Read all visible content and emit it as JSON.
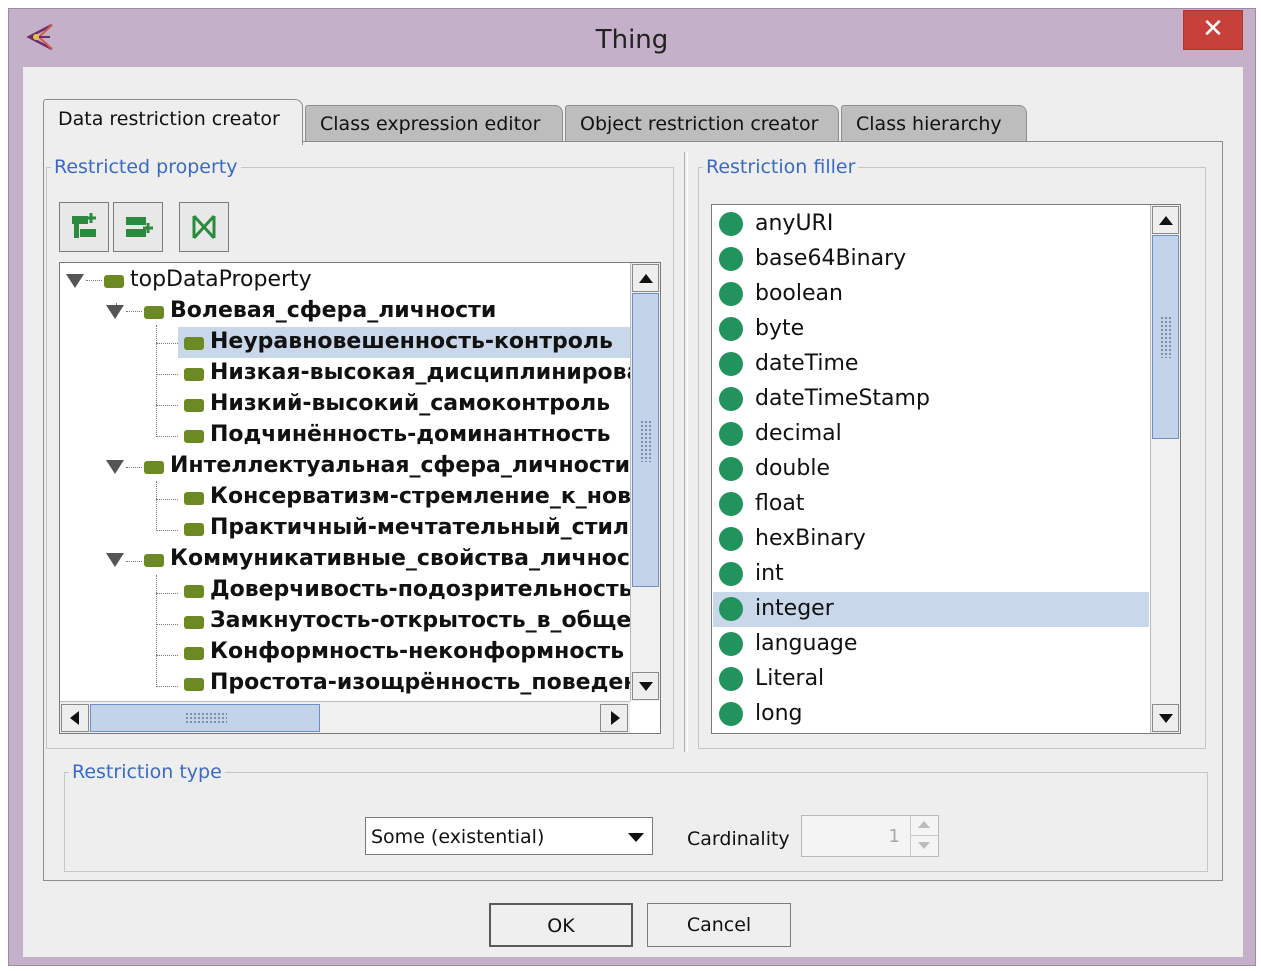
{
  "window": {
    "title": "Thing",
    "close_label": "✕"
  },
  "tabs": [
    {
      "label": "Data restriction creator",
      "active": true
    },
    {
      "label": "Class expression editor",
      "active": false
    },
    {
      "label": "Object restriction creator",
      "active": false
    },
    {
      "label": "Class hierarchy",
      "active": false
    }
  ],
  "restricted_property": {
    "legend": "Restricted property",
    "toolbar": [
      {
        "icon": "add-subproperty-icon"
      },
      {
        "icon": "add-sibling-property-icon"
      },
      {
        "icon": "delete-property-icon"
      }
    ],
    "tree": [
      {
        "label": "topDataProperty",
        "level": 0,
        "expanded": true,
        "bold": false,
        "selected": false
      },
      {
        "label": "Волевая_сфера_личности",
        "level": 1,
        "expanded": true,
        "bold": true,
        "selected": false
      },
      {
        "label": "Неуравновешенность-контроль",
        "level": 2,
        "bold": true,
        "selected": true
      },
      {
        "label": "Низкая-высокая_дисциплинированность",
        "level": 2,
        "bold": true,
        "selected": false
      },
      {
        "label": "Низкий-высокий_самоконтроль",
        "level": 2,
        "bold": true,
        "selected": false
      },
      {
        "label": "Подчинённость-доминантность",
        "level": 2,
        "bold": true,
        "selected": false
      },
      {
        "label": "Интеллектуальная_сфера_личности",
        "level": 1,
        "expanded": true,
        "bold": true,
        "selected": false
      },
      {
        "label": "Консерватизм-стремление_к_новому",
        "level": 2,
        "bold": true,
        "selected": false
      },
      {
        "label": "Практичный-мечтательный_стиль",
        "level": 2,
        "bold": true,
        "selected": false
      },
      {
        "label": "Коммуникативные_свойства_личности",
        "level": 1,
        "expanded": true,
        "bold": true,
        "selected": false
      },
      {
        "label": "Доверчивость-подозрительность",
        "level": 2,
        "bold": true,
        "selected": false
      },
      {
        "label": "Замкнутость-открытость_в_общении",
        "level": 2,
        "bold": true,
        "selected": false
      },
      {
        "label": "Конформность-неконформность",
        "level": 2,
        "bold": true,
        "selected": false
      },
      {
        "label": "Простота-изощрённость_поведения",
        "level": 2,
        "bold": true,
        "selected": false
      }
    ]
  },
  "restriction_filler": {
    "legend": "Restriction filler",
    "items": [
      {
        "label": "anyURI",
        "selected": false
      },
      {
        "label": "base64Binary",
        "selected": false
      },
      {
        "label": "boolean",
        "selected": false
      },
      {
        "label": "byte",
        "selected": false
      },
      {
        "label": "dateTime",
        "selected": false
      },
      {
        "label": "dateTimeStamp",
        "selected": false
      },
      {
        "label": "decimal",
        "selected": false
      },
      {
        "label": "double",
        "selected": false
      },
      {
        "label": "float",
        "selected": false
      },
      {
        "label": "hexBinary",
        "selected": false
      },
      {
        "label": "int",
        "selected": false
      },
      {
        "label": "integer",
        "selected": true
      },
      {
        "label": "language",
        "selected": false
      },
      {
        "label": "Literal",
        "selected": false
      },
      {
        "label": "long",
        "selected": false
      }
    ]
  },
  "restriction_type": {
    "legend": "Restriction type",
    "selected": "Some (existential)",
    "cardinality_label": "Cardinality",
    "cardinality_value": "1"
  },
  "buttons": {
    "ok": "OK",
    "cancel": "Cancel"
  },
  "colors": {
    "window_frame": "#c4b0c9",
    "close_button": "#c7413a",
    "legend_text": "#3a6ac4",
    "selection": "#c8d7ea",
    "datatype_dot": "#23935e",
    "property_node": "#6b8a23"
  }
}
